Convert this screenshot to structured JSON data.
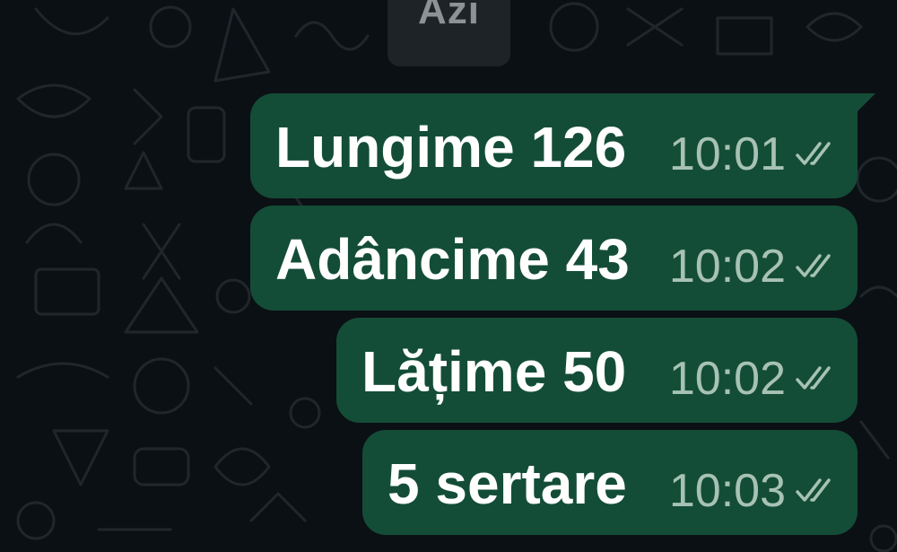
{
  "chat": {
    "date_separator": "Azi",
    "messages": [
      {
        "text": "Lungime 126",
        "time": "10:01",
        "status": "read-double-check-icon"
      },
      {
        "text": "Adâncime 43",
        "time": "10:02",
        "status": "read-double-check-icon"
      },
      {
        "text": "Lățime 50",
        "time": "10:02",
        "status": "read-double-check-icon"
      },
      {
        "text": "5 sertare",
        "time": "10:03",
        "status": "read-double-check-icon"
      }
    ]
  },
  "colors": {
    "background": "#0b1014",
    "outgoing_bubble": "#144d37",
    "message_text": "#ffffff",
    "timestamp": "#a7c2b5",
    "date_chip": "#1d2326",
    "date_chip_text": "#8c9296"
  }
}
